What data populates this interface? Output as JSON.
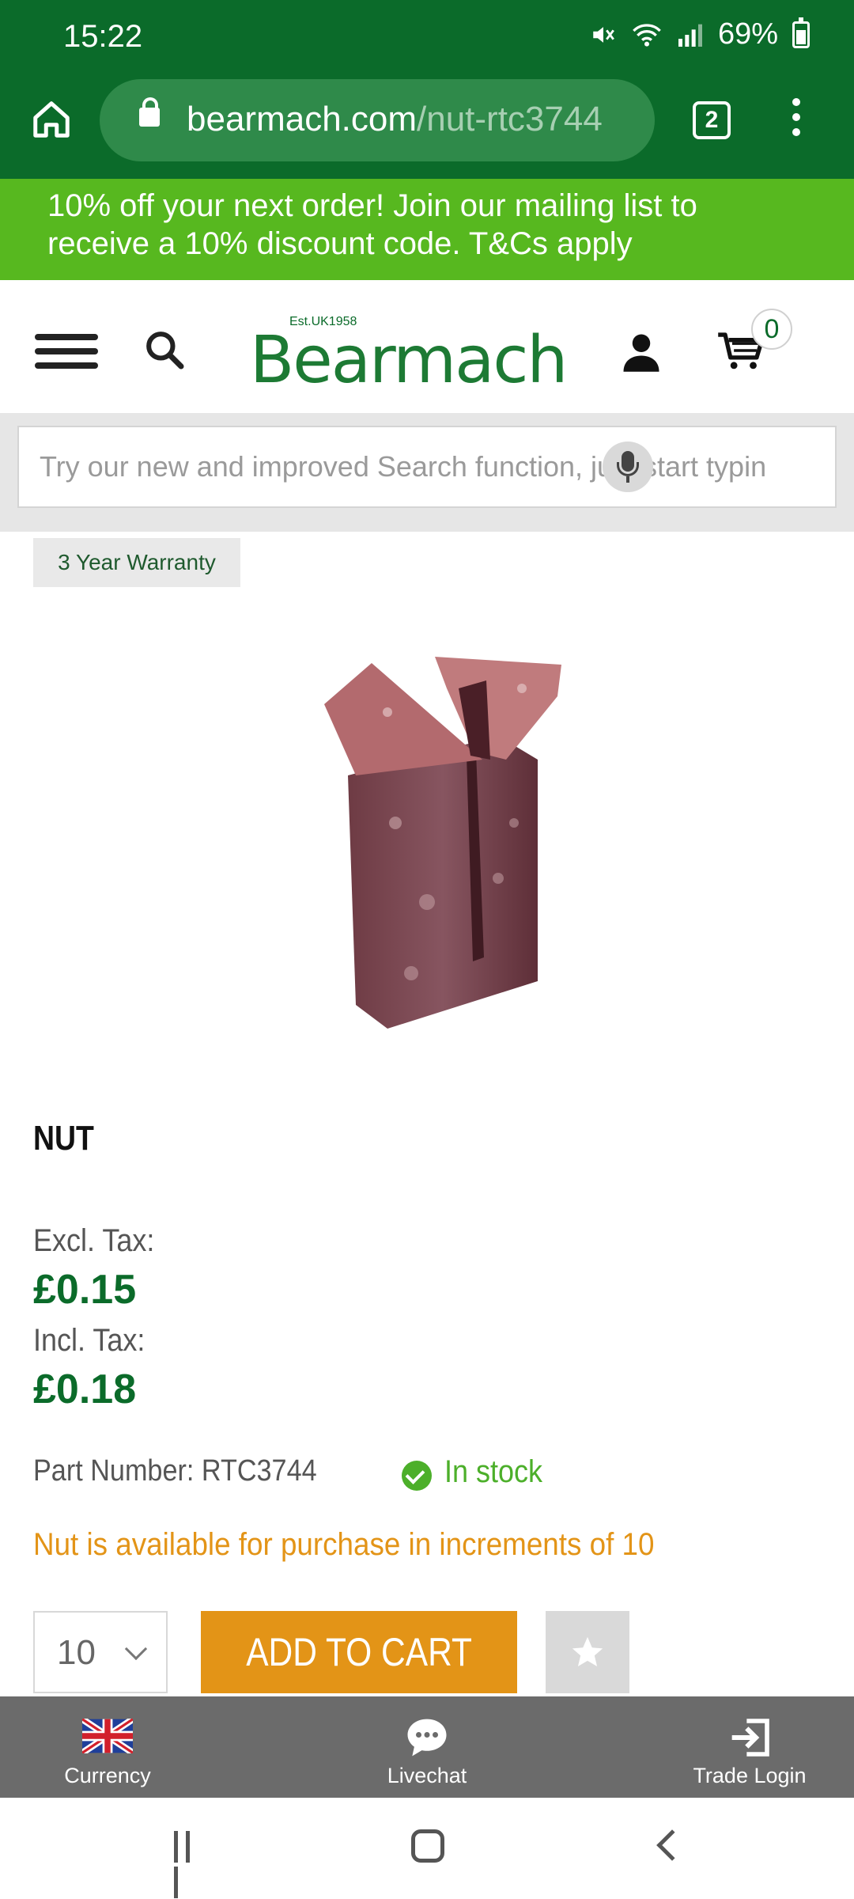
{
  "status_bar": {
    "time": "15:22",
    "battery": "69%"
  },
  "browser": {
    "url_host": "bearmach.com",
    "url_path": "/nut-rtc3744",
    "tab_count": "2"
  },
  "promo": {
    "text": "10% off your next order! Join our mailing list to receive a 10% discount code. T&Cs apply"
  },
  "header": {
    "logo_est": "Est.UK1958",
    "logo": "Bearmach",
    "cart_count": "0"
  },
  "search": {
    "placeholder": "Try our new and improved Search function, just start typing"
  },
  "product": {
    "badge": "3 Year Warranty",
    "title": "NUT",
    "excl_label": "Excl. Tax:",
    "excl_price": "£0.15",
    "incl_label": "Incl. Tax:",
    "incl_price": "£0.18",
    "part_number": "Part Number: RTC3744",
    "stock": "In stock",
    "increment_note": "Nut is available for purchase in increments of 10",
    "quantity": "10",
    "add_to_cart": "ADD TO CART",
    "wishlist_icon": "star-icon"
  },
  "bottom_bar": {
    "currency": "Currency",
    "livechat": "Livechat",
    "trade_login": "Trade Login"
  },
  "colors": {
    "brand_green": "#0b6b2a",
    "promo_green": "#57b81f",
    "accent_orange": "#e39417",
    "stock_green": "#4caf2a"
  }
}
